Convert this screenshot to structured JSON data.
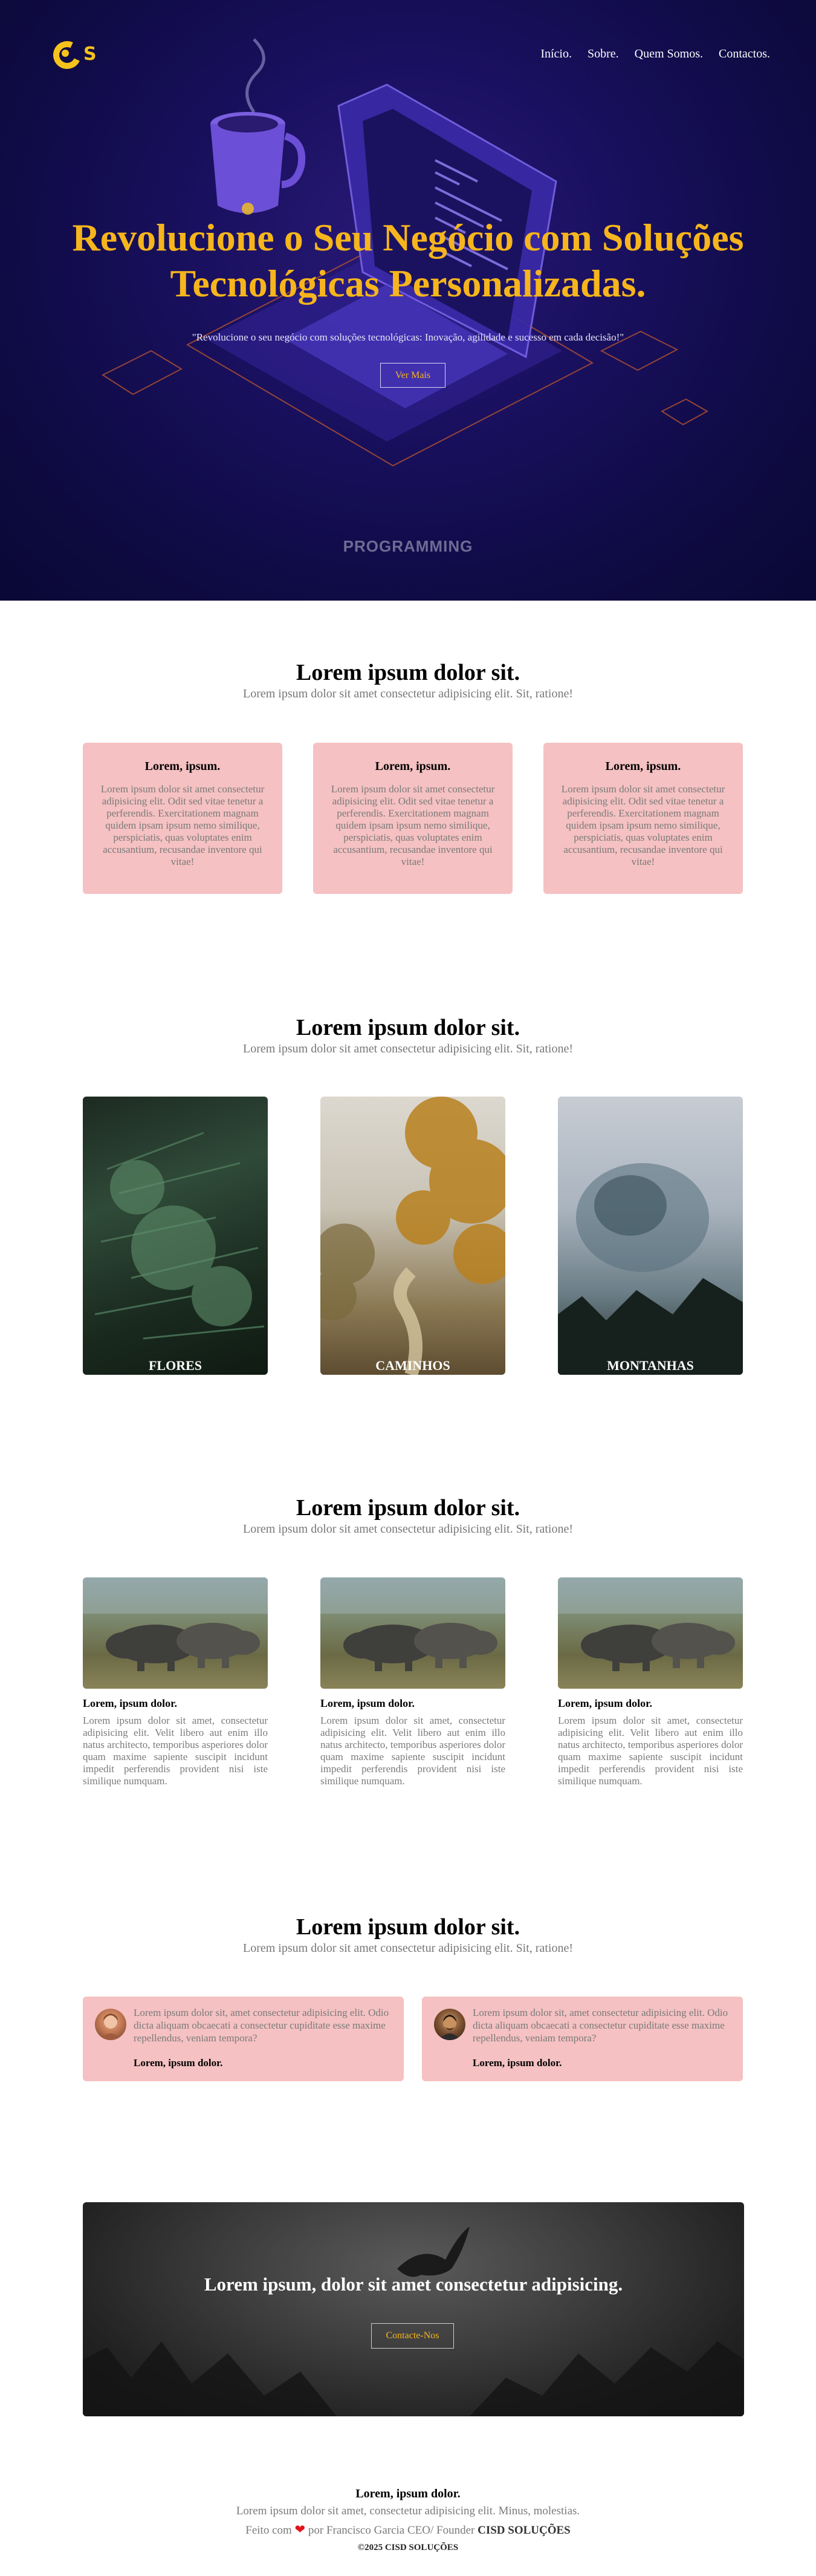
{
  "header": {
    "logo_text": "S",
    "nav": [
      "Início.",
      "Sobre.",
      "Quem Somos.",
      "Contactos."
    ]
  },
  "hero": {
    "title": "Revolucione o Seu Negócio com Soluções Tecnológicas Personalizadas.",
    "subtitle": "\"Revolucione o seu negócio com soluções tecnológicas: Inovação, agilidade e sucesso em cada decisão!\"",
    "button": "Ver Mais",
    "caption": "PROGRAMMING"
  },
  "services": {
    "title": "Lorem ipsum dolor sit.",
    "subtitle": "Lorem ipsum dolor sit amet consectetur adipisicing elit. Sit, ratione!",
    "cards": [
      {
        "title": "Lorem, ipsum.",
        "text": "Lorem ipsum dolor sit amet consectetur adipisicing elit. Odit sed vitae tenetur a perferendis. Exercitationem magnam quidem ipsam ipsum nemo similique, perspiciatis, quas voluptates enim accusantium, recusandae inventore qui vitae!"
      },
      {
        "title": "Lorem, ipsum.",
        "text": "Lorem ipsum dolor sit amet consectetur adipisicing elit. Odit sed vitae tenetur a perferendis. Exercitationem magnam quidem ipsam ipsum nemo similique, perspiciatis, quas voluptates enim accusantium, recusandae inventore qui vitae!"
      },
      {
        "title": "Lorem, ipsum.",
        "text": "Lorem ipsum dolor sit amet consectetur adipisicing elit. Odit sed vitae tenetur a perferendis. Exercitationem magnam quidem ipsam ipsum nemo similique, perspiciatis, quas voluptates enim accusantium, recusandae inventore qui vitae!"
      }
    ]
  },
  "gallery": {
    "title": "Lorem ipsum dolor sit.",
    "subtitle": "Lorem ipsum dolor sit amet consectetur adipisicing elit. Sit, ratione!",
    "items": [
      "FLORES",
      "CAMINHOS",
      "MONTANHAS"
    ]
  },
  "posts": {
    "title": "Lorem ipsum dolor sit.",
    "subtitle": "Lorem ipsum dolor sit amet consectetur adipisicing elit. Sit, ratione!",
    "items": [
      {
        "title": "Lorem, ipsum dolor.",
        "text": "Lorem ipsum dolor sit amet, consectetur adipisicing elit. Velit libero aut enim illo natus architecto, temporibus asperiores dolor quam maxime sapiente suscipit incidunt impedit perferendis provident nisi iste similique numquam."
      },
      {
        "title": "Lorem, ipsum dolor.",
        "text": "Lorem ipsum dolor sit amet, consectetur adipisicing elit. Velit libero aut enim illo natus architecto, temporibus asperiores dolor quam maxime sapiente suscipit incidunt impedit perferendis provident nisi iste similique numquam."
      },
      {
        "title": "Lorem, ipsum dolor.",
        "text": "Lorem ipsum dolor sit amet, consectetur adipisicing elit. Velit libero aut enim illo natus architecto, temporibus asperiores dolor quam maxime sapiente suscipit incidunt impedit perferendis provident nisi iste similique numquam."
      }
    ]
  },
  "testimonials": {
    "title": "Lorem ipsum dolor sit.",
    "subtitle": "Lorem ipsum dolor sit amet consectetur adipisicing elit. Sit, ratione!",
    "items": [
      {
        "quote": "Lorem ipsum dolor sit, amet consectetur adipisicing elit. Odio dicta aliquam obcaecati a consectetur cupiditate esse maxime repellendus, veniam tempora?",
        "name": "Lorem, ipsum dolor."
      },
      {
        "quote": "Lorem ipsum dolor sit, amet consectetur adipisicing elit. Odio dicta aliquam obcaecati a consectetur cupiditate esse maxime repellendus, veniam tempora?",
        "name": "Lorem, ipsum dolor."
      }
    ]
  },
  "cta": {
    "title": "Lorem ipsum, dolor sit amet consectetur adipisicing.",
    "button": "Contacte-Nos"
  },
  "footer": {
    "title": "Lorem, ipsum dolor.",
    "text": "Lorem ipsum dolor sit amet, consectetur adipisicing elit. Minus, molestias.",
    "made_prefix": "Feito com",
    "made_suffix": "por Francisco Garcia CEO/ Founder",
    "company": "CISD SOLUÇÕES",
    "copyright": "©2025 CISD SOLUÇÕES"
  },
  "colors": {
    "accent": "#f6b51c",
    "hero_bg": "#150e52",
    "card_pink": "#f5c1c2",
    "heart": "#e0151b"
  }
}
